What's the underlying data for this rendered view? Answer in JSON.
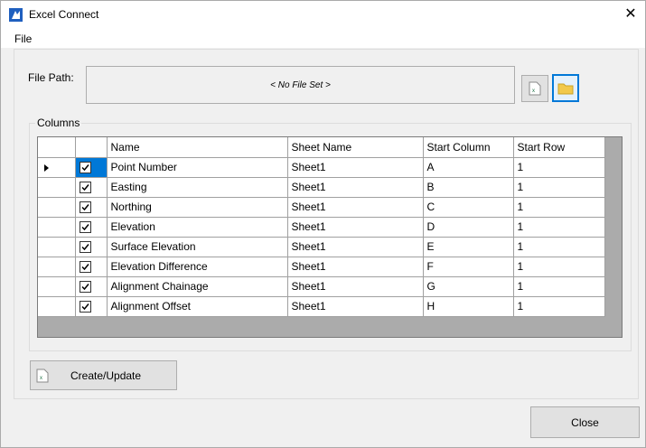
{
  "window": {
    "title": "Excel Connect"
  },
  "menu": {
    "file": "File"
  },
  "file_path": {
    "label": "File Path:",
    "value": "< No File Set >"
  },
  "columns_group": {
    "legend": "Columns"
  },
  "grid": {
    "headers": [
      "Name",
      "Sheet Name",
      "Start Column",
      "Start Row"
    ],
    "rows": [
      {
        "checked": true,
        "name": "Point Number",
        "sheet": "Sheet1",
        "col": "A",
        "row": "1"
      },
      {
        "checked": true,
        "name": "Easting",
        "sheet": "Sheet1",
        "col": "B",
        "row": "1"
      },
      {
        "checked": true,
        "name": "Northing",
        "sheet": "Sheet1",
        "col": "C",
        "row": "1"
      },
      {
        "checked": true,
        "name": "Elevation",
        "sheet": "Sheet1",
        "col": "D",
        "row": "1"
      },
      {
        "checked": true,
        "name": "Surface Elevation",
        "sheet": "Sheet1",
        "col": "E",
        "row": "1"
      },
      {
        "checked": true,
        "name": "Elevation Difference",
        "sheet": "Sheet1",
        "col": "F",
        "row": "1"
      },
      {
        "checked": true,
        "name": "Alignment Chainage",
        "sheet": "Sheet1",
        "col": "G",
        "row": "1"
      },
      {
        "checked": true,
        "name": "Alignment Offset",
        "sheet": "Sheet1",
        "col": "H",
        "row": "1"
      }
    ]
  },
  "buttons": {
    "create_update": "Create/Update",
    "close": "Close"
  },
  "icons": {
    "app": "app-logo-icon",
    "excel": "excel-icon",
    "folder": "folder-icon",
    "close": "close-icon",
    "row_indicator": "row-indicator-arrow-icon"
  },
  "colors": {
    "accent": "#0078d7",
    "excel_green": "#1e7145",
    "folder_yellow": "#f2c94c"
  }
}
